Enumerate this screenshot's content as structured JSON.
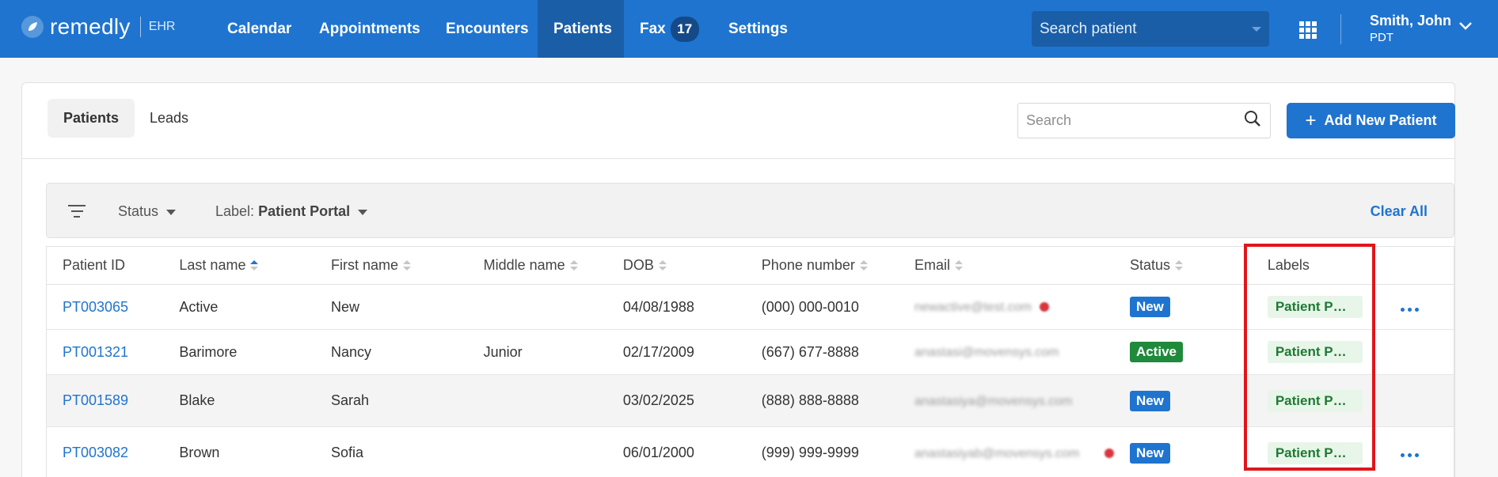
{
  "brand": {
    "name": "remedly",
    "sub": "EHR"
  },
  "nav": {
    "items": [
      {
        "label": "Calendar"
      },
      {
        "label": "Appointments"
      },
      {
        "label": "Encounters"
      },
      {
        "label": "Patients"
      },
      {
        "label": "Fax"
      },
      {
        "label": "Settings"
      }
    ],
    "fax_count": "17",
    "search_placeholder": "Search patient",
    "user_name": "Smith, John",
    "user_tz": "PDT"
  },
  "tabs": [
    {
      "label": "Patients",
      "active": true
    },
    {
      "label": "Leads",
      "active": false
    }
  ],
  "search": {
    "placeholder": "Search"
  },
  "add_button": {
    "label": "Add New Patient"
  },
  "filters": {
    "status_label": "Status",
    "label_prefix": "Label:",
    "label_value": "Patient Portal",
    "clear_all": "Clear All"
  },
  "table": {
    "columns": [
      "Patient ID",
      "Last name",
      "First name",
      "Middle name",
      "DOB",
      "Phone number",
      "Email",
      "Status",
      "Labels"
    ],
    "rows": [
      {
        "id": "PT003065",
        "last": "Active",
        "first": "New",
        "middle": "",
        "dob": "04/08/1988",
        "phone": "(000) 000-0010",
        "email": "newactive@test.com",
        "status": "New",
        "label": "Patient Portal"
      },
      {
        "id": "PT001321",
        "last": "Barimore",
        "first": "Nancy",
        "middle": "Junior",
        "dob": "02/17/2009",
        "phone": "(667) 677-8888",
        "email": "anastasi@movensys.com",
        "status": "Active",
        "label": "Patient Portal"
      },
      {
        "id": "PT001589",
        "last": "Blake",
        "first": "Sarah",
        "middle": "",
        "dob": "03/02/2025",
        "phone": "(888) 888-8888",
        "email": "anastasiya@movensys.com",
        "status": "New",
        "label": "Patient Portal"
      },
      {
        "id": "PT003082",
        "last": "Brown",
        "first": "Sofia",
        "middle": "",
        "dob": "06/01/2000",
        "phone": "(999) 999-9999",
        "email": "anastasiyab@movensys.com",
        "status": "New",
        "label": "Patient Portal"
      }
    ]
  },
  "colors": {
    "primary": "#1f74cf",
    "nav_active": "#1a5ea8",
    "status_active": "#1f8a3b",
    "label_bg": "#e8f5e9",
    "highlight": "#e0161b"
  }
}
